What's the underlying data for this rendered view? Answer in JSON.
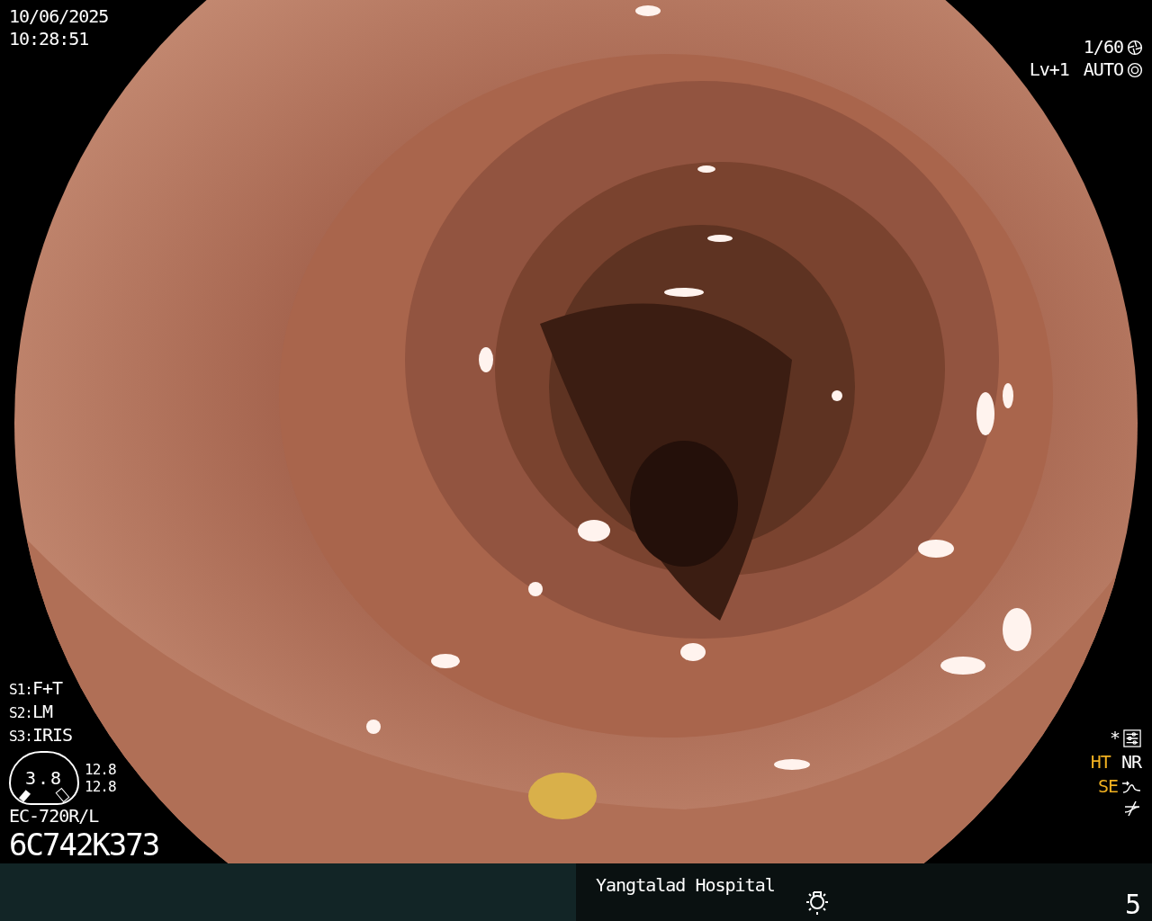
{
  "date": "10/06/2025",
  "time": "10:28:51",
  "shutter": "1/60",
  "brightness_level": "Lv+1",
  "iris_mode": "AUTO",
  "switches": [
    {
      "label": "S1:",
      "value": "F+T"
    },
    {
      "label": "S2:",
      "value": "LM"
    },
    {
      "label": "S3:",
      "value": "IRIS"
    }
  ],
  "zoom": {
    "value": "3.8",
    "readings": [
      "12.8",
      "12.8"
    ]
  },
  "scope": {
    "model": "EC-720R/L",
    "serial": "6C742K373"
  },
  "mark": "*",
  "enhancements": [
    {
      "label": "HT",
      "on": true
    },
    {
      "label": "NR",
      "on": false
    },
    {
      "label": "SE",
      "on": true
    }
  ],
  "footer": {
    "hospital": "Yangtalad Hospital",
    "number": "5"
  }
}
